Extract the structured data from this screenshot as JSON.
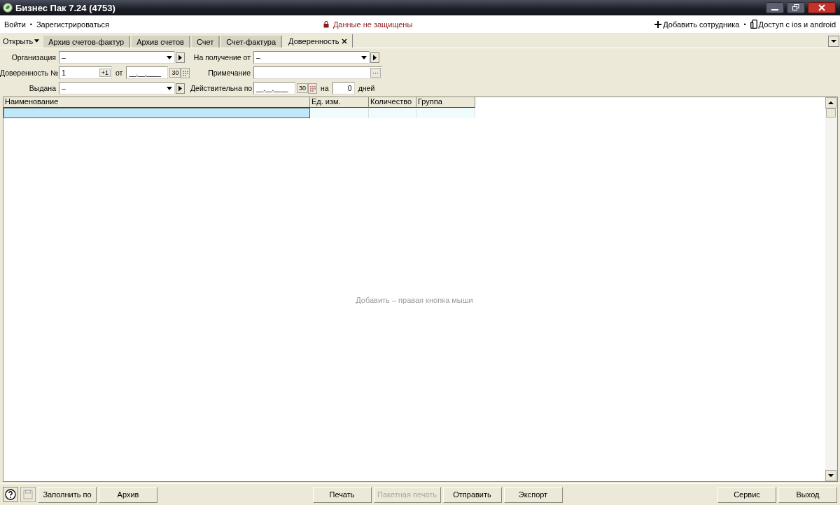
{
  "window": {
    "title": "Бизнес Пак 7.24 (4753)"
  },
  "menu_bar": {
    "left": [
      {
        "kind": "link",
        "label": "Войти"
      },
      {
        "kind": "separator",
        "label": "•"
      },
      {
        "kind": "link",
        "label": "Зарегистрироваться"
      }
    ],
    "status": "Данные не защищены",
    "right": [
      {
        "kind": "add",
        "label": "Добавить сотрудника"
      },
      {
        "kind": "separator",
        "label": "•"
      },
      {
        "kind": "phone",
        "label": "Доступ с ios и android"
      }
    ]
  },
  "open_menu": "Открыть",
  "tabs": [
    {
      "label": "Архив счетов-фактур",
      "selected": false,
      "closable": false
    },
    {
      "label": "Архив счетов",
      "selected": false,
      "closable": false
    },
    {
      "label": "Счет",
      "selected": false,
      "closable": false
    },
    {
      "label": "Счет-фактура",
      "selected": false,
      "closable": false
    },
    {
      "label": "Доверенность",
      "selected": true,
      "closable": true
    }
  ],
  "form": [
    {
      "label": "Организация",
      "kind": "combo",
      "choice": "–"
    },
    {
      "label": "На получение от",
      "kind": "combo",
      "choice": "–"
    },
    {
      "label": "Доверенность №",
      "kind": "number",
      "value": "1",
      "step": "+1",
      "date_label": "от",
      "date": "__.__.____",
      "today": "30"
    },
    {
      "label": "Примечание",
      "kind": "text",
      "more": "···"
    },
    {
      "label": "Выдана",
      "kind": "combo",
      "choice": "–"
    },
    {
      "label": "Действительна по",
      "kind": "date",
      "date": "__.__.____",
      "today": "30",
      "days_label": "на",
      "days": "0",
      "days_unit": "дней"
    }
  ],
  "table": {
    "columns": [
      "Наименование",
      "Ед. изм.",
      "Количество",
      "Группа"
    ],
    "rows": [
      {
        "selected": true
      }
    ],
    "empty_hint": "Добавить – правая кнопка мыши"
  },
  "toolbar": {
    "left": [
      {
        "label": "Заполнить по",
        "disabled": false
      },
      {
        "label": "Архив",
        "disabled": false
      }
    ],
    "center": [
      {
        "label": "Печать",
        "disabled": false
      },
      {
        "label": "Пакетная печать",
        "disabled": true
      },
      {
        "label": "Отправить",
        "disabled": false
      },
      {
        "label": "Экспорт",
        "disabled": false
      }
    ],
    "right": [
      {
        "label": "Сервис",
        "disabled": false
      },
      {
        "label": "Выход",
        "disabled": false
      }
    ]
  }
}
